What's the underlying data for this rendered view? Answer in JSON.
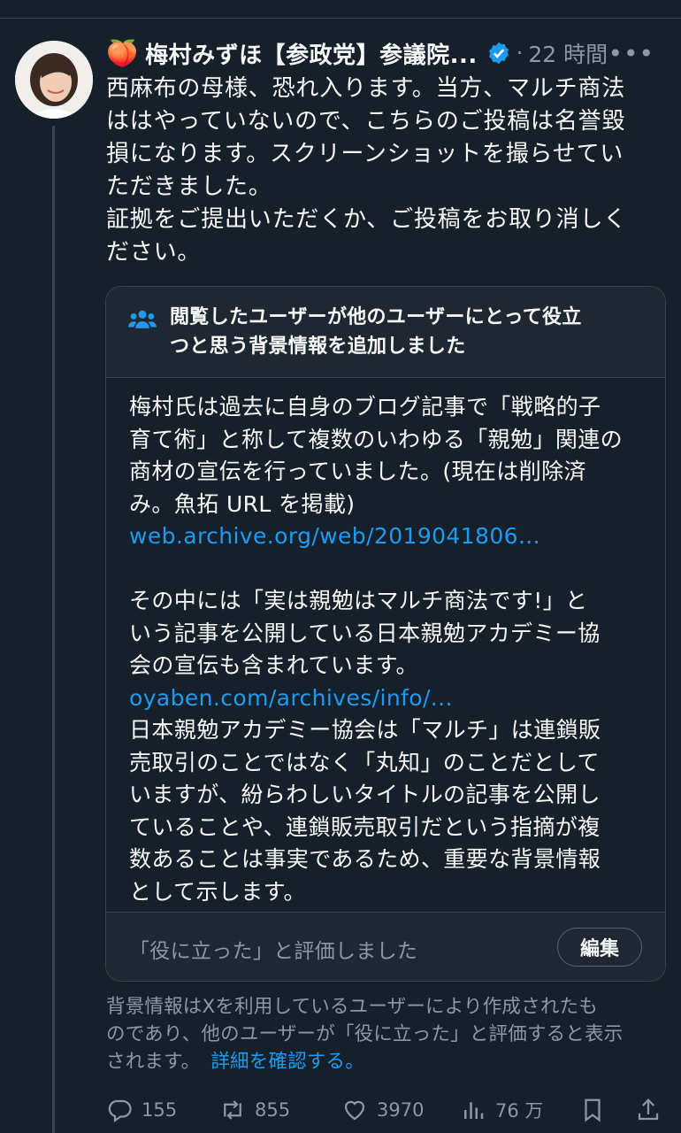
{
  "post": {
    "author_emoji": "🍑",
    "author_name": "梅村みずほ【参政党】参議院...",
    "timestamp": "22 時間",
    "more": "•••",
    "body": "西麻布の母様、恐れ入ります。当方、マルチ商法\nははやっていないので、こちらのご投稿は名誉毀\n損になります。スクリーンショットを撮らせてい\nただきました。\n証拠をご提出いただくか、ご投稿をお取り消しく\nださい。"
  },
  "note": {
    "title": "閲覧したユーザーが他のユーザーにとって役立\nつと思う背景情報を追加しました",
    "para1": "梅村氏は過去に自身のブログ記事で「戦略的子\n育て術」と称して複数のいわゆる「親勉」関連の\n商材の宣伝を行っていました。(現在は削除済\nみ。魚拓 URL を掲載)",
    "link1": "web.archive.org/web/2019041806...",
    "para2": "その中には「実は親勉はマルチ商法です!」と\nいう記事を公開している日本親勉アカデミー協\n会の宣伝も含まれています。",
    "link2": "oyaben.com/archives/info/...",
    "para3": "日本親勉アカデミー協会は「マルチ」は連鎖販\n売取引のことではなく「丸知」のことだとして\nいますが、紛らわしいタイトルの記事を公開し\nていることや、連鎖販売取引だという指摘が複\n数あることは事実であるため、重要な背景情報\nとして示します。",
    "rated_text": "「役に立った」と評価しました",
    "edit_label": "編集"
  },
  "disclaimer": {
    "text": "背景情報はXを利用しているユーザーにより作成されたも\nのであり、他のユーザーが「役に立った」と評価すると表示\nされます。",
    "link": "詳細を確認する。"
  },
  "actions": {
    "replies": "155",
    "reposts": "855",
    "likes": "3970",
    "views": "76 万"
  },
  "colors": {
    "background": "#15202b",
    "accent": "#1d9bf0",
    "muted": "#8b98a5",
    "border": "#38444d"
  }
}
